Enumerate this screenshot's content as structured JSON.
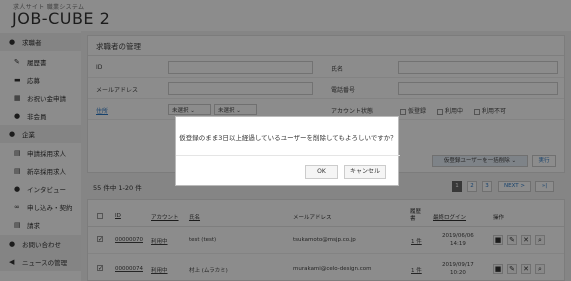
{
  "brand": {
    "subtitle": "求人サイト 職業システム",
    "name": "JOB-CUBE 2"
  },
  "sidebar": [
    {
      "label": "求職者",
      "kind": "sec",
      "icon": "person-icon"
    },
    {
      "label": "履歴書",
      "kind": "sub",
      "icon": "pencil-icon"
    },
    {
      "label": "応募",
      "kind": "sub",
      "icon": "folder-icon"
    },
    {
      "label": "お祝い金申請",
      "kind": "sub",
      "icon": "gift-icon"
    },
    {
      "label": "非会員",
      "kind": "sub",
      "icon": "person-icon"
    },
    {
      "label": "企業",
      "kind": "sec",
      "icon": "people-icon"
    },
    {
      "label": "申請採用求人",
      "kind": "sub",
      "icon": "copy-icon"
    },
    {
      "label": "新卒採用求人",
      "kind": "sub",
      "icon": "copy-icon"
    },
    {
      "label": "インタビュー",
      "kind": "sub",
      "icon": "people-icon"
    },
    {
      "label": "申し込み・契約",
      "kind": "sub",
      "icon": "link-icon"
    },
    {
      "label": "請求",
      "kind": "sub",
      "icon": "doc-icon"
    },
    {
      "label": "お問い合わせ",
      "kind": "sec",
      "icon": "info-icon"
    },
    {
      "label": "ニュースの管理",
      "kind": "sec",
      "icon": "megaphone-icon"
    }
  ],
  "panel": {
    "title": "求職者の管理",
    "id_label": "ID",
    "name_label": "氏名",
    "email_label": "メールアドレス",
    "phone_label": "電話番号",
    "status_link": "住所",
    "pref_select": "未選択",
    "city_select": "未選択",
    "account_label": "アカウント状態",
    "checks": [
      "仮登録",
      "利用中",
      "利用不可"
    ]
  },
  "bulk": {
    "select": "仮登録ユーザーを一括削除",
    "button": "実行"
  },
  "results": {
    "count": "55 件中 1-20 件",
    "pages": [
      "1",
      "2",
      "3",
      "NEXT >",
      "»|"
    ]
  },
  "table": {
    "headers": [
      "ID",
      "アカウント",
      "氏名",
      "メールアドレス",
      "履歴書",
      "最終ログイン",
      "操作"
    ],
    "rows": [
      {
        "id": "00000070",
        "account": "利用中",
        "name": "test (test)",
        "email": "tsukamoto@msjp.co.jp",
        "resume": "1 件",
        "login": [
          "2019/06/06",
          "14:19"
        ]
      },
      {
        "id": "00000074",
        "account": "利用中",
        "name": "村上 (ムラカミ)",
        "email": "murakami@celo-design.com",
        "resume": "1 件",
        "login": [
          "2019/09/17",
          "10:20"
        ]
      }
    ]
  },
  "dialog": {
    "message": "仮登録のまま3日以上経過しているユーザーを削除してもよろしいですか？",
    "ok": "OK",
    "cancel": "キャンセル"
  },
  "colors": {
    "accent": "#2a78c6",
    "active_page": "#666666"
  }
}
